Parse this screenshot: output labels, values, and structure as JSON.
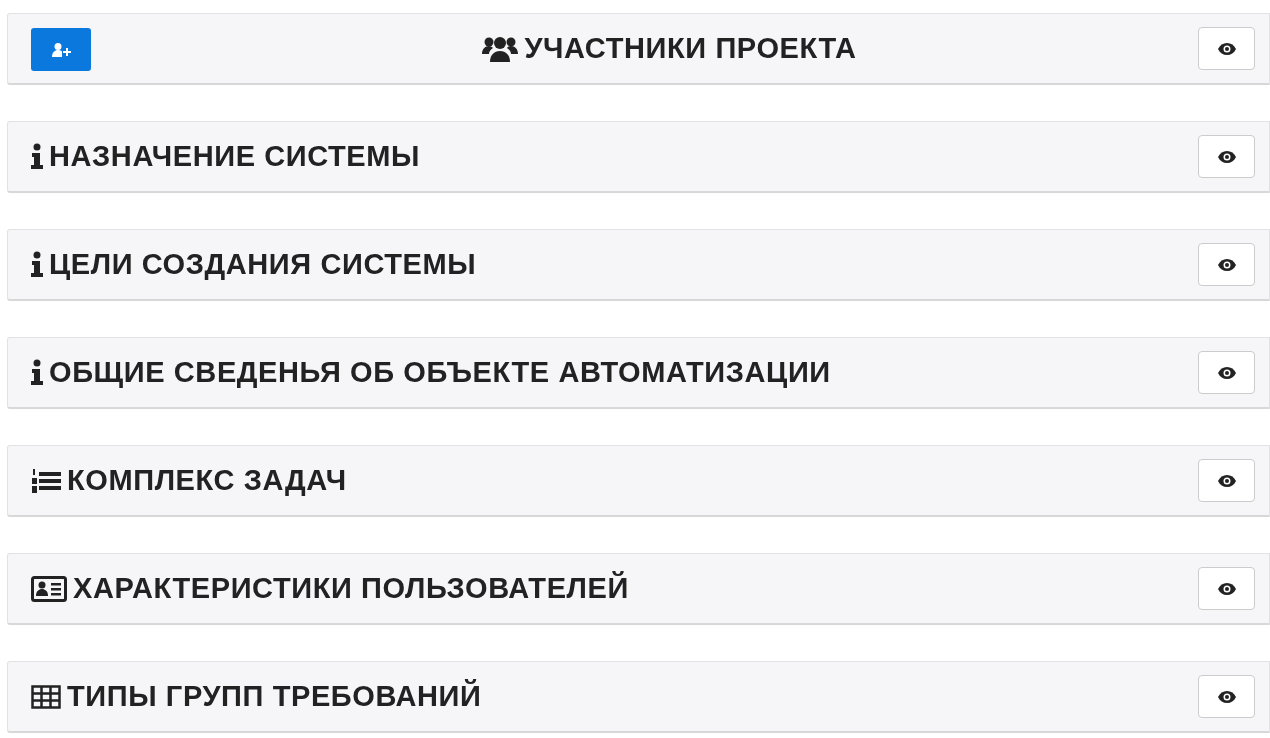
{
  "sections": [
    {
      "title": "УЧАСТНИКИ ПРОЕКТА",
      "kind": "users",
      "centered": true,
      "add_button": true
    },
    {
      "title": "НАЗНАЧЕНИЕ СИСТЕМЫ",
      "kind": "info",
      "centered": false,
      "add_button": false
    },
    {
      "title": "ЦЕЛИ СОЗДАНИЯ СИСТЕМЫ",
      "kind": "info",
      "centered": false,
      "add_button": false
    },
    {
      "title": "ОБЩИЕ СВЕДЕНЬЯ ОБ ОБЪЕКТЕ АВТОМАТИЗАЦИИ",
      "kind": "info",
      "centered": false,
      "add_button": false
    },
    {
      "title": "КОМПЛЕКС ЗАДАЧ",
      "kind": "ordered-list",
      "centered": false,
      "add_button": false
    },
    {
      "title": "ХАРАКТЕРИСТИКИ ПОЛЬЗОВАТЕЛЕЙ",
      "kind": "id-card",
      "centered": false,
      "add_button": false
    },
    {
      "title": "ТИПЫ ГРУПП ТРЕБОВАНИЙ",
      "kind": "table",
      "centered": false,
      "add_button": false
    }
  ]
}
